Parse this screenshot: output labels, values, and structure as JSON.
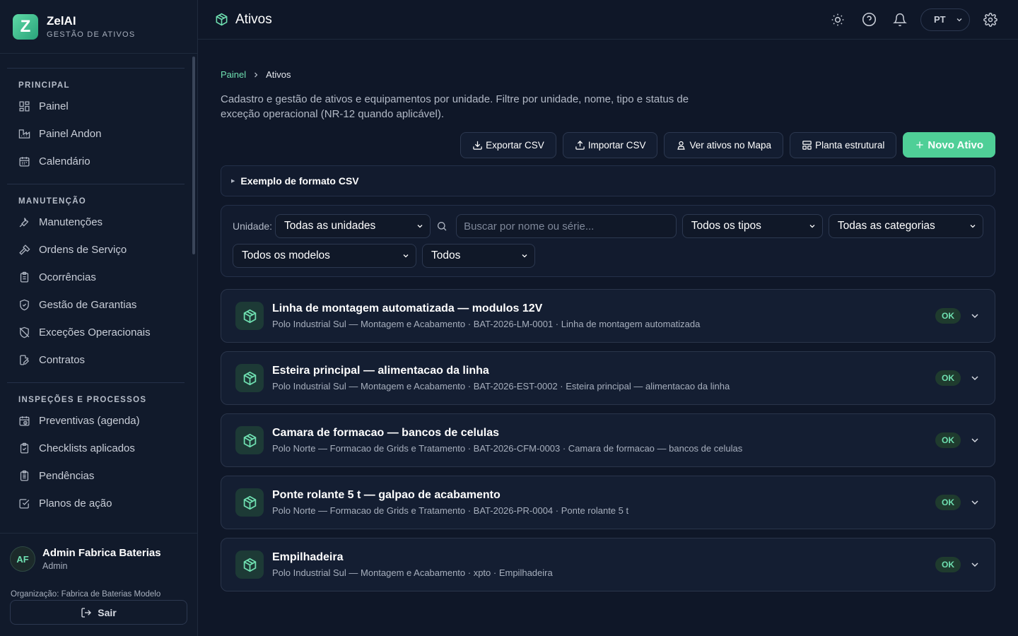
{
  "brand": {
    "logo_letter": "Z",
    "name": "ZelAI",
    "subtitle": "GESTÃO DE ATIVOS"
  },
  "sidebar": {
    "sections": [
      {
        "title": "PRINCIPAL",
        "items": [
          {
            "label": "Painel",
            "icon": "grid-icon"
          },
          {
            "label": "Painel Andon",
            "icon": "factory-icon"
          },
          {
            "label": "Calendário",
            "icon": "calendar-icon"
          }
        ]
      },
      {
        "title": "MANUTENÇÃO",
        "items": [
          {
            "label": "Manutenções",
            "icon": "wrench-icon"
          },
          {
            "label": "Ordens de Serviço",
            "icon": "hammer-icon"
          },
          {
            "label": "Ocorrências",
            "icon": "clipboard-icon"
          },
          {
            "label": "Gestão de Garantias",
            "icon": "shield-check-icon"
          },
          {
            "label": "Exceções Operacionais",
            "icon": "shield-off-icon"
          },
          {
            "label": "Contratos",
            "icon": "file-edit-icon"
          }
        ]
      },
      {
        "title": "INSPEÇÕES E PROCESSOS",
        "items": [
          {
            "label": "Preventivas (agenda)",
            "icon": "calendar-clock-icon"
          },
          {
            "label": "Checklists aplicados",
            "icon": "clipboard-check-icon"
          },
          {
            "label": "Pendências",
            "icon": "clipboard-list-icon"
          },
          {
            "label": "Planos de ação",
            "icon": "check-square-icon"
          }
        ]
      }
    ]
  },
  "user": {
    "initials": "AF",
    "name": "Admin Fabrica Baterias",
    "role": "Admin",
    "organization": "Organização: Fabrica de Baterias Modelo",
    "logout_label": "Sair"
  },
  "topbar": {
    "title": "Ativos",
    "language": "PT"
  },
  "breadcrumb": {
    "home": "Painel",
    "current": "Ativos"
  },
  "description": "Cadastro e gestão de ativos e equipamentos por unidade. Filtre por unidade, nome, tipo e status de exceção operacional (NR-12 quando aplicável).",
  "actions": {
    "export": "Exportar CSV",
    "import": "Importar CSV",
    "map": "Ver ativos no Mapa",
    "plan": "Planta estrutural",
    "new": "Novo Ativo"
  },
  "csv_example": "Exemplo de formato CSV",
  "filters": {
    "unit_label": "Unidade:",
    "unit": "Todas as unidades",
    "search_placeholder": "Buscar por nome ou série...",
    "type": "Todos os tipos",
    "category": "Todas as categorias",
    "model": "Todos os modelos",
    "status": "Todos"
  },
  "assets": [
    {
      "title": "Linha de montagem automatizada — modulos 12V",
      "subtitle": "Polo Industrial Sul — Montagem e Acabamento · BAT-2026-LM-0001 · Linha de montagem automatizada",
      "status": "OK"
    },
    {
      "title": "Esteira principal — alimentacao da linha",
      "subtitle": "Polo Industrial Sul — Montagem e Acabamento · BAT-2026-EST-0002 · Esteira principal — alimentacao da linha",
      "status": "OK"
    },
    {
      "title": "Camara de formacao — bancos de celulas",
      "subtitle": "Polo Norte — Formacao de Grids e Tratamento · BAT-2026-CFM-0003 · Camara de formacao — bancos de celulas",
      "status": "OK"
    },
    {
      "title": "Ponte rolante 5 t — galpao de acabamento",
      "subtitle": "Polo Norte — Formacao de Grids e Tratamento · BAT-2026-PR-0004 · Ponte rolante 5 t",
      "status": "OK"
    },
    {
      "title": "Empilhadeira",
      "subtitle": "Polo Industrial Sul — Montagem e Acabamento · xpto · Empilhadeira",
      "status": "OK"
    }
  ],
  "colors": {
    "accent": "#4fcf97",
    "background": "#0f1728",
    "sidebar": "#111a2b"
  }
}
